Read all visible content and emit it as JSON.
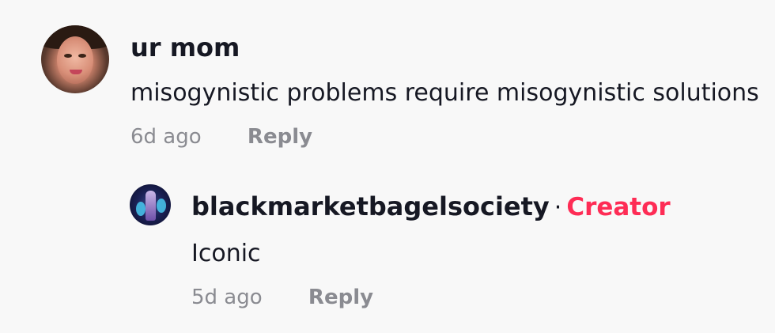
{
  "comments": [
    {
      "username": "ur mom",
      "text": "misogynistic problems require misogynistic solutions",
      "time": "6d ago",
      "reply_label": "Reply",
      "avatar_icon": "user-photo-avatar"
    }
  ],
  "reply": {
    "username": "blackmarketbagelsociety",
    "separator": "·",
    "badge": "Creator",
    "text": "Iconic",
    "time": "5d ago",
    "reply_label": "Reply",
    "avatar_icon": "creator-photo-avatar"
  },
  "colors": {
    "background": "#f8f8f8",
    "username": "#161823",
    "meta": "#8a8b91",
    "creator_badge": "#fe2c55"
  }
}
